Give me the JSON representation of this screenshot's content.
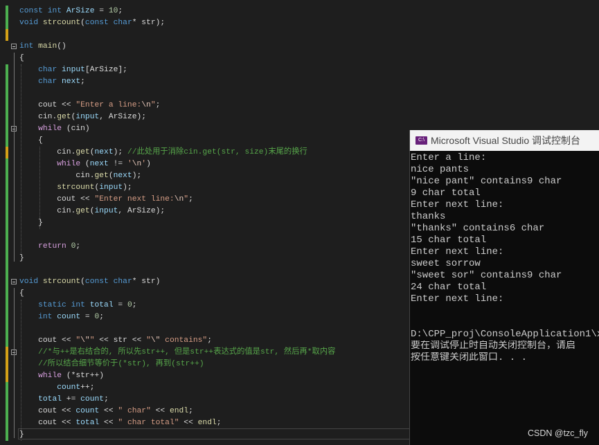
{
  "colors": {
    "background": "#1e1e1e",
    "keyword": "#569cd6",
    "control": "#d8a0df",
    "function": "#dcdcaa",
    "variable": "#9cdcfe",
    "string": "#d69d85",
    "comment": "#57a64a",
    "number": "#b5cea8",
    "change_saved": "#4caf50",
    "change_unsaved": "#d4a017"
  },
  "code_lines": [
    [
      [
        "kw",
        "const "
      ],
      [
        "kw",
        "int "
      ],
      [
        "var",
        "ArSize"
      ],
      [
        "pl",
        " = "
      ],
      [
        "num",
        "10"
      ],
      [
        "pl",
        ";"
      ]
    ],
    [
      [
        "kw",
        "void "
      ],
      [
        "fn",
        "strcount"
      ],
      [
        "pl",
        "("
      ],
      [
        "kw",
        "const "
      ],
      [
        "kw",
        "char"
      ],
      [
        "pl",
        "* "
      ],
      [
        "pl",
        "str);"
      ]
    ],
    [],
    [
      [
        "kw",
        "int "
      ],
      [
        "fn",
        "main"
      ],
      [
        "pl",
        "()"
      ]
    ],
    [
      [
        "pl",
        "{"
      ]
    ],
    [
      [
        "pl",
        "    "
      ],
      [
        "kw",
        "char "
      ],
      [
        "var",
        "input"
      ],
      [
        "pl",
        "[ArSize];"
      ]
    ],
    [
      [
        "pl",
        "    "
      ],
      [
        "kw",
        "char "
      ],
      [
        "var",
        "next"
      ],
      [
        "pl",
        ";"
      ]
    ],
    [],
    [
      [
        "pl",
        "    cout << "
      ],
      [
        "str",
        "\"Enter a line:"
      ],
      [
        "esc",
        "\\n"
      ],
      [
        "str",
        "\""
      ],
      [
        "pl",
        ";"
      ]
    ],
    [
      [
        "pl",
        "    cin."
      ],
      [
        "fn",
        "get"
      ],
      [
        "pl",
        "("
      ],
      [
        "var",
        "input"
      ],
      [
        "pl",
        ", ArSize);"
      ]
    ],
    [
      [
        "pl",
        "    "
      ],
      [
        "ctl",
        "while "
      ],
      [
        "pl",
        "(cin)"
      ]
    ],
    [
      [
        "pl",
        "    {"
      ]
    ],
    [
      [
        "pl",
        "        cin."
      ],
      [
        "fn",
        "get"
      ],
      [
        "pl",
        "("
      ],
      [
        "var",
        "next"
      ],
      [
        "pl",
        "); "
      ],
      [
        "cmt",
        "//此处用于消除cin.get(str, size)末尾的换行"
      ]
    ],
    [
      [
        "pl",
        "        "
      ],
      [
        "ctl",
        "while "
      ],
      [
        "pl",
        "("
      ],
      [
        "var",
        "next"
      ],
      [
        "pl",
        " != "
      ],
      [
        "str",
        "'"
      ],
      [
        "esc",
        "\\n"
      ],
      [
        "str",
        "'"
      ],
      [
        "pl",
        ")"
      ]
    ],
    [
      [
        "pl",
        "            cin."
      ],
      [
        "fn",
        "get"
      ],
      [
        "pl",
        "("
      ],
      [
        "var",
        "next"
      ],
      [
        "pl",
        ");"
      ]
    ],
    [
      [
        "pl",
        "        "
      ],
      [
        "fn",
        "strcount"
      ],
      [
        "pl",
        "("
      ],
      [
        "var",
        "input"
      ],
      [
        "pl",
        ");"
      ]
    ],
    [
      [
        "pl",
        "        cout << "
      ],
      [
        "str",
        "\"Enter next line:"
      ],
      [
        "esc",
        "\\n"
      ],
      [
        "str",
        "\""
      ],
      [
        "pl",
        ";"
      ]
    ],
    [
      [
        "pl",
        "        cin."
      ],
      [
        "fn",
        "get"
      ],
      [
        "pl",
        "("
      ],
      [
        "var",
        "input"
      ],
      [
        "pl",
        ", ArSize);"
      ]
    ],
    [
      [
        "pl",
        "    }"
      ]
    ],
    [],
    [
      [
        "pl",
        "    "
      ],
      [
        "ctl",
        "return "
      ],
      [
        "num",
        "0"
      ],
      [
        "pl",
        ";"
      ]
    ],
    [
      [
        "pl",
        "}"
      ]
    ],
    [],
    [
      [
        "kw",
        "void "
      ],
      [
        "fn",
        "strcount"
      ],
      [
        "pl",
        "("
      ],
      [
        "kw",
        "const "
      ],
      [
        "kw",
        "char"
      ],
      [
        "pl",
        "* str)"
      ]
    ],
    [
      [
        "pl",
        "{"
      ]
    ],
    [
      [
        "pl",
        "    "
      ],
      [
        "kw",
        "static "
      ],
      [
        "kw",
        "int "
      ],
      [
        "var",
        "total"
      ],
      [
        "pl",
        " = "
      ],
      [
        "num",
        "0"
      ],
      [
        "pl",
        ";"
      ]
    ],
    [
      [
        "pl",
        "    "
      ],
      [
        "kw",
        "int "
      ],
      [
        "var",
        "count"
      ],
      [
        "pl",
        " = "
      ],
      [
        "num",
        "0"
      ],
      [
        "pl",
        ";"
      ]
    ],
    [],
    [
      [
        "pl",
        "    cout << "
      ],
      [
        "str",
        "\""
      ],
      [
        "esc",
        "\\\""
      ],
      [
        "str",
        "\""
      ],
      [
        "pl",
        " << str << "
      ],
      [
        "str",
        "\""
      ],
      [
        "esc",
        "\\\""
      ],
      [
        "str",
        " contains\""
      ],
      [
        "pl",
        ";"
      ]
    ],
    [
      [
        "pl",
        "    "
      ],
      [
        "cmt",
        "//*与++是右结合的, 所以先str++, 但是str++表达式的值是str, 然后再*取内容"
      ]
    ],
    [
      [
        "pl",
        "    "
      ],
      [
        "cmt",
        "//所以结合细节等价于(*str), 再到(str++)"
      ]
    ],
    [
      [
        "pl",
        "    "
      ],
      [
        "ctl",
        "while "
      ],
      [
        "pl",
        "(*str++)"
      ]
    ],
    [
      [
        "pl",
        "        "
      ],
      [
        "var",
        "count"
      ],
      [
        "pl",
        "++;"
      ]
    ],
    [
      [
        "pl",
        "    "
      ],
      [
        "var",
        "total"
      ],
      [
        "pl",
        " += "
      ],
      [
        "var",
        "count"
      ],
      [
        "pl",
        ";"
      ]
    ],
    [
      [
        "pl",
        "    cout << "
      ],
      [
        "var",
        "count"
      ],
      [
        "pl",
        " << "
      ],
      [
        "str",
        "\" char\""
      ],
      [
        "pl",
        " << "
      ],
      [
        "fn",
        "endl"
      ],
      [
        "pl",
        ";"
      ]
    ],
    [
      [
        "pl",
        "    cout << "
      ],
      [
        "var",
        "total"
      ],
      [
        "pl",
        " << "
      ],
      [
        "str",
        "\" char total\""
      ],
      [
        "pl",
        " << "
      ],
      [
        "fn",
        "endl"
      ],
      [
        "pl",
        ";"
      ]
    ],
    [
      [
        "pl",
        "}"
      ]
    ]
  ],
  "console": {
    "icon": "visual-studio-console-icon",
    "title": "Microsoft Visual Studio 调试控制台",
    "lines": [
      "Enter a line:",
      "nice pants",
      "\"nice pant\" contains9 char",
      "9 char total",
      "Enter next line:",
      "thanks",
      "\"thanks\" contains6 char",
      "15 char total",
      "Enter next line:",
      "sweet sorrow",
      "\"sweet sor\" contains9 char",
      "24 char total",
      "Enter next line:",
      "",
      "",
      "D:\\CPP_proj\\ConsoleApplication1\\x",
      "要在调试停止时自动关闭控制台，请启",
      "按任意键关闭此窗口. . ."
    ]
  },
  "watermark": "CSDN @tzc_fly"
}
